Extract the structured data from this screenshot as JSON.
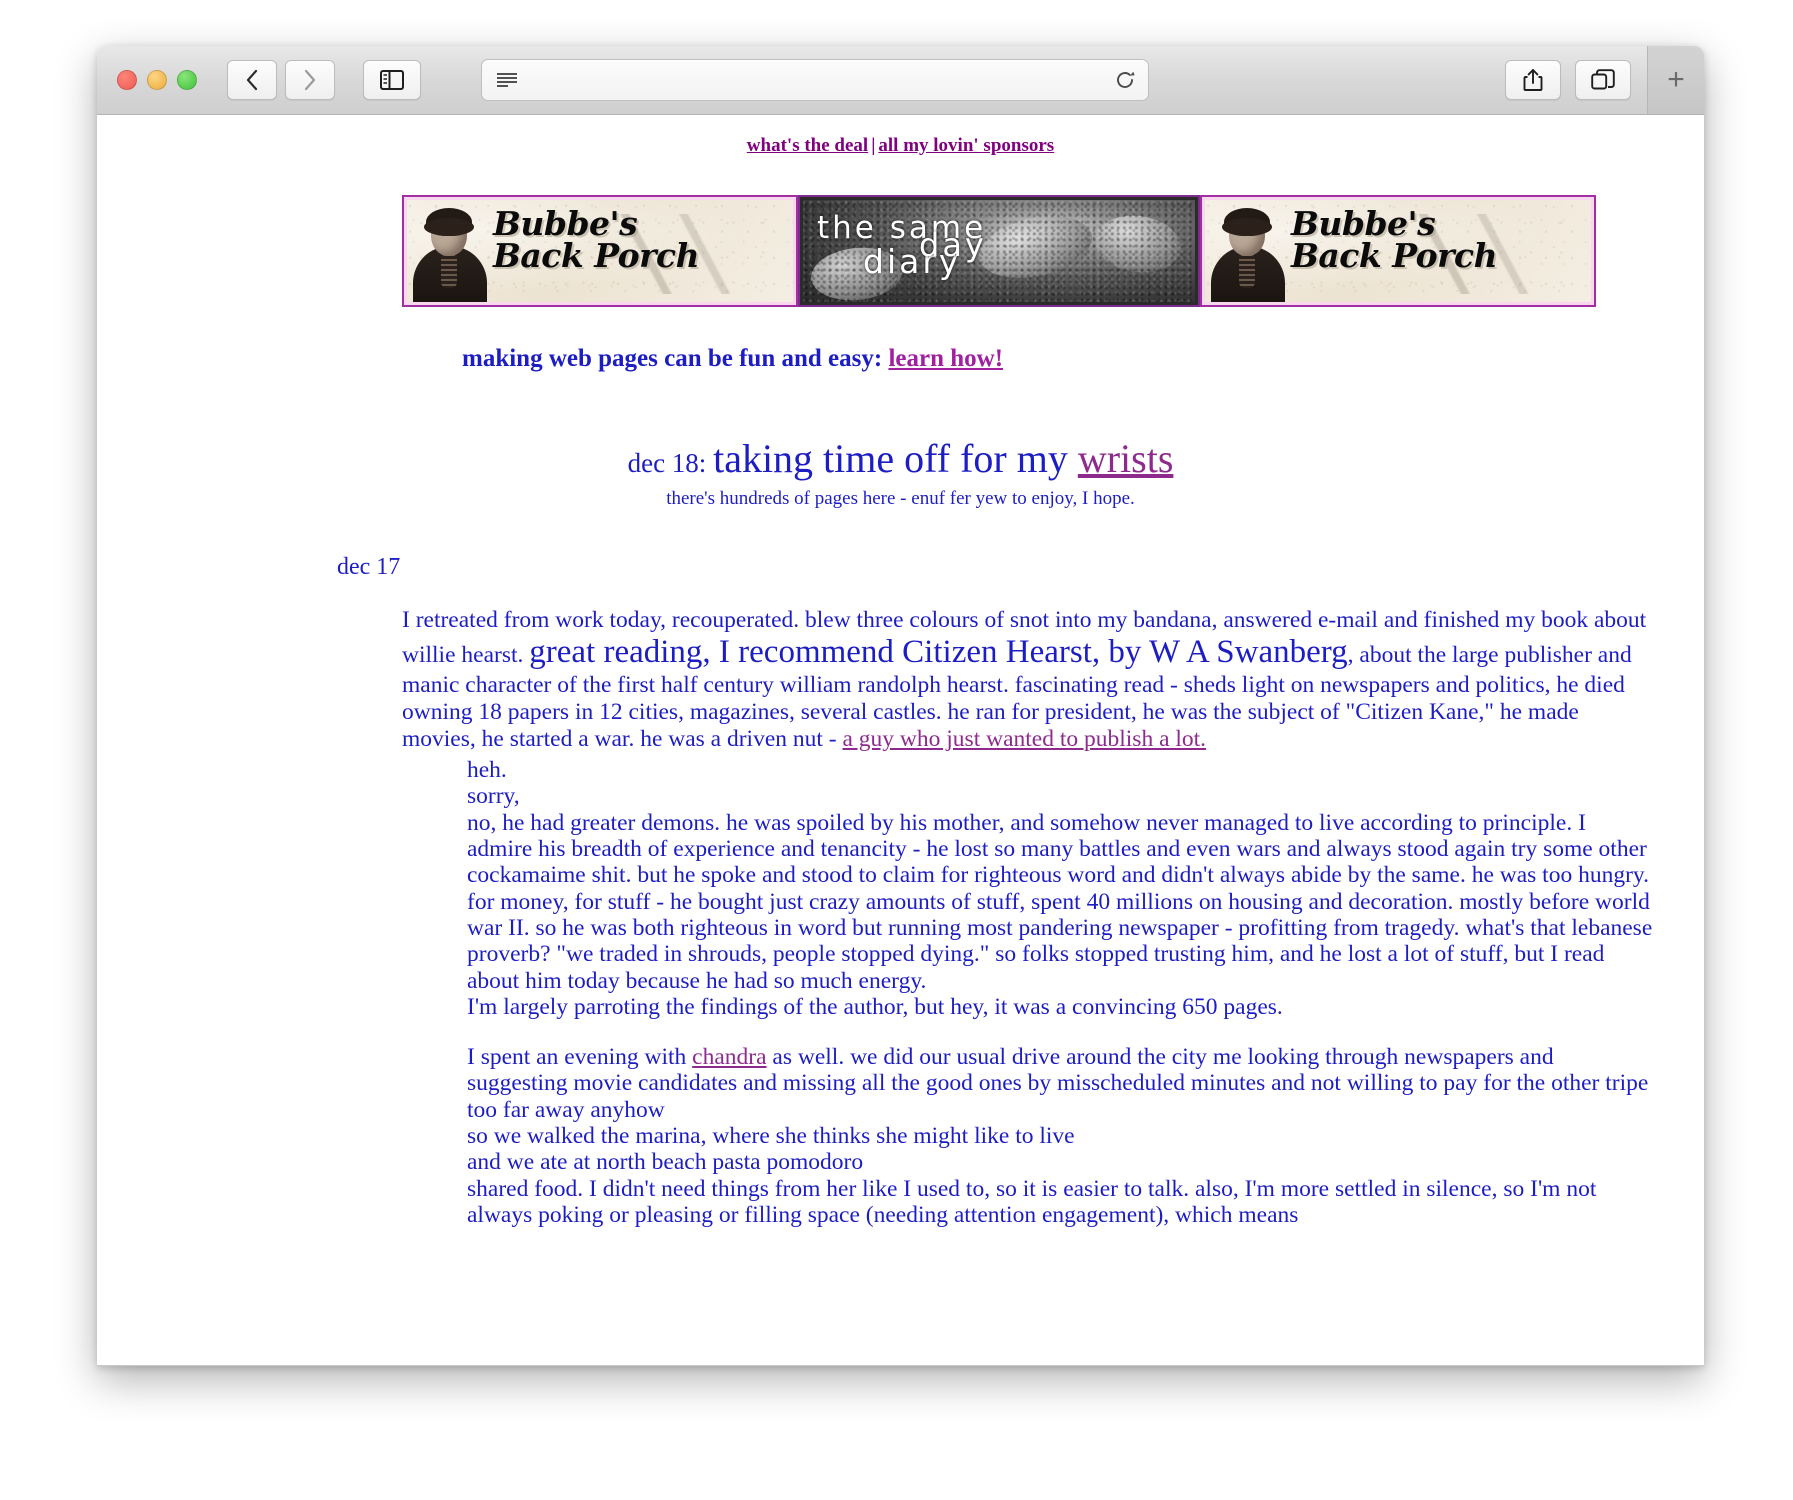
{
  "browser": {
    "traffic_lights": [
      "close",
      "minimize",
      "zoom"
    ],
    "back_label": "‹",
    "forward_label": "›",
    "sidebar_icon": "sidebar-icon",
    "reader_icon": "reader-view-icon",
    "reload_icon": "reload-icon",
    "share_icon": "share-icon",
    "tabs_icon": "show-tabs-icon",
    "new_tab_label": "+",
    "url_value": "",
    "url_placeholder": ""
  },
  "page": {
    "topnav": {
      "link1": "what's the deal",
      "separator": "|",
      "link2": "all my lovin' sponsors"
    },
    "banners": [
      {
        "name": "bubbes-back-porch",
        "line1": "Bubbe's",
        "line2": "Back Porch"
      },
      {
        "name": "the-same-day-diary",
        "word1": "the same",
        "word2": "diary",
        "word3": "day"
      },
      {
        "name": "bubbes-back-porch",
        "line1": "Bubbe's",
        "line2": "Back Porch"
      }
    ],
    "tagline": {
      "text": "making web pages can be fun and easy: ",
      "link": "learn how!"
    },
    "entry": {
      "date": "dec 18: ",
      "headline": "taking time off for my ",
      "headline_link": "wrists",
      "subtitle": "there's hundreds of pages here - enuf fer yew to enjoy, I hope.",
      "prev_date": "dec 17"
    },
    "body": {
      "p1_a": "I retreated from work today, recouperated. blew three colours of snot into my bandana, answered e-mail and finished my book about willie hearst. ",
      "p1_big": "great reading, I recommend Citizen Hearst, by W A Swanberg",
      "p1_b": ", about the large publisher and manic character of the first half century william randolph hearst. fascinating read - sheds light on newspapers and politics, he died owning 18 papers in 12 cities, magazines, several castles. he ran for president, he was the subject of \"Citizen Kane,\" he made movies, he started a war. he was a driven nut - ",
      "p1_link": "a guy who just wanted to publish a lot.",
      "indent_line1": "heh.",
      "indent_line2": "sorry,",
      "indent_p1": "no, he had greater demons. he was spoiled by his mother, and somehow never managed to live according to principle. I admire his breadth of experience and tenancity - he lost so many battles and even wars and always stood again try some other cockamaime shit. but he spoke and stood to claim for righteous word and didn't always abide by the same. he was too hungry. for money, for stuff - he bought just crazy amounts of stuff, spent 40 millions on housing and decoration. mostly before world war II. so he was both righteous in word but running most pandering newspaper - profitting from tragedy. what's that lebanese proverb? \"we traded in shrouds, people stopped dying.\" so folks stopped trusting him, and he lost a lot of stuff, but I read about him today because he had so much energy.",
      "indent_p2": "I'm largely parroting the findings of the author, but hey, it was a convincing 650 pages.",
      "indent_p3_a": "I spent an evening with ",
      "indent_p3_link": "chandra",
      "indent_p3_b": " as well. we did our usual drive around the city me looking through newspapers and suggesting movie candidates and missing all the good ones by misscheduled minutes and not willing to pay for the other tripe too far away anyhow",
      "indent_p4": "so we walked the marina, where she thinks she might like to live",
      "indent_p5": "and we ate at north beach pasta pomodoro",
      "indent_p6": "shared food. I didn't need things from her like I used to, so it is easier to talk. also, I'm more settled in silence, so I'm not always poking or pleasing or filling space (needing attention engagement), which means"
    }
  },
  "colors": {
    "link_purple": "#800080",
    "body_blue": "#1d1dc4",
    "inline_link": "#8e2a8e",
    "banner_border": "#a12fa1",
    "diary_border": "#7b2c8c"
  }
}
